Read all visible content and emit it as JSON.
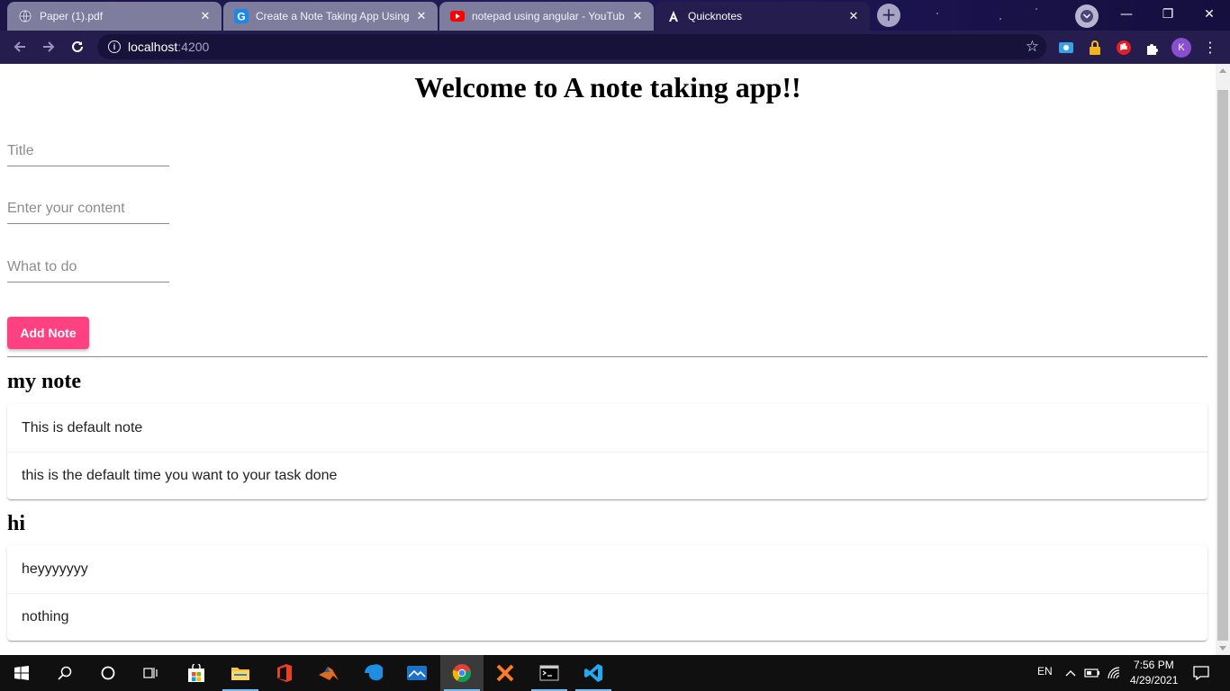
{
  "browser": {
    "tabs": [
      {
        "title": "Paper (1).pdf",
        "favicon": "globe-icon",
        "active": false
      },
      {
        "title": "Create a Note Taking App Using",
        "favicon": "g-icon",
        "active": false
      },
      {
        "title": "notepad using angular - YouTube",
        "favicon": "youtube-icon",
        "active": false
      },
      {
        "title": "Quicknotes",
        "favicon": "angular-icon",
        "active": true
      }
    ],
    "close_glyph": "✕",
    "new_tab_glyph": "+",
    "address": {
      "host": "localhost",
      "port": ":4200"
    },
    "profile_initial": "K",
    "window_controls": {
      "minimize": "—",
      "restore": "❐",
      "close": "✕"
    }
  },
  "page": {
    "heading": "Welcome to A note taking app!!",
    "form": {
      "title_placeholder": "Title",
      "content_placeholder": "Enter your content",
      "todo_placeholder": "What to do",
      "title_value": "",
      "content_value": "",
      "todo_value": "",
      "add_button": "Add Note"
    },
    "notes": [
      {
        "title": "my note",
        "lines": [
          "This is default note",
          "this is the default time you want to your task done"
        ]
      },
      {
        "title": "hi",
        "lines": [
          "heyyyyyyy",
          "nothing"
        ]
      }
    ]
  },
  "taskbar": {
    "language": "EN",
    "time": "7:56 PM",
    "date": "4/29/2021"
  },
  "colors": {
    "accent": "#ff4081",
    "chrome_frame": "#241d4e",
    "taskbar": "#101010"
  }
}
